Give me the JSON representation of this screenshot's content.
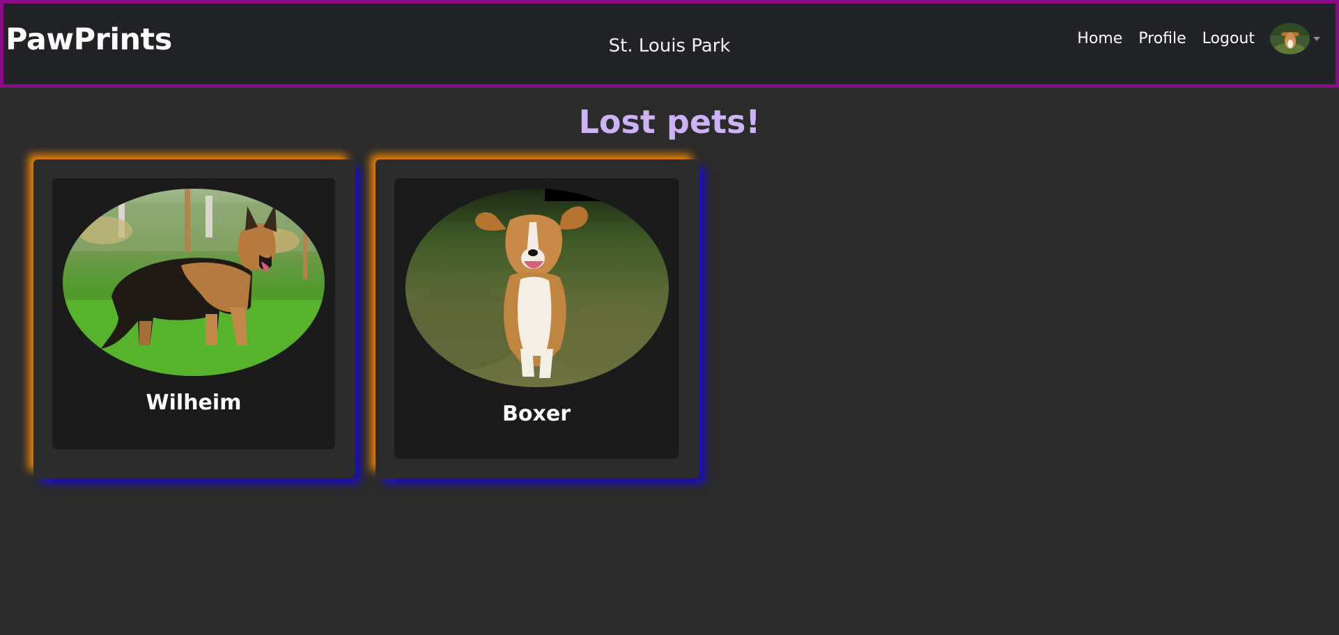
{
  "navbar": {
    "brand": "PawPrints",
    "location": "St. Louis Park",
    "links": [
      "Home",
      "Profile",
      "Logout"
    ],
    "avatar_icon": "user-avatar-photo-beagle"
  },
  "page": {
    "title": "Lost pets!"
  },
  "pets": [
    {
      "name": "Wilheim",
      "photo": "german-shepherd-standing-on-grass"
    },
    {
      "name": "Boxer",
      "photo": "beagle-running-on-grass"
    }
  ],
  "colors": {
    "background": "#2b2b2b",
    "navbar_bg": "#212327",
    "navbar_border": "#8a0a88",
    "title": "#cdb3f5",
    "card_glow_top_left": "#ff8c00",
    "card_glow_bottom_right": "#180ad7"
  }
}
